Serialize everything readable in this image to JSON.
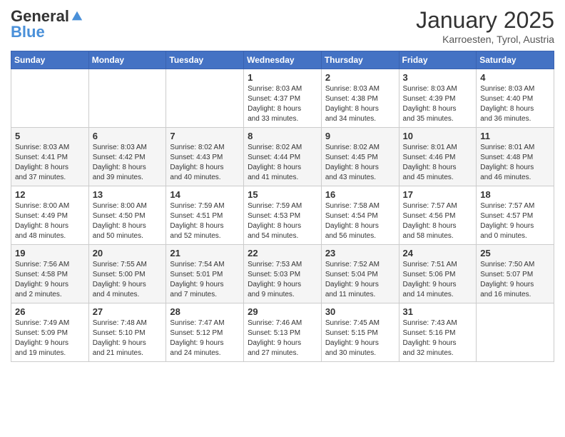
{
  "header": {
    "logo_general": "General",
    "logo_blue": "Blue",
    "month": "January 2025",
    "location": "Karroesten, Tyrol, Austria"
  },
  "weekdays": [
    "Sunday",
    "Monday",
    "Tuesday",
    "Wednesday",
    "Thursday",
    "Friday",
    "Saturday"
  ],
  "weeks": [
    [
      {
        "day": "",
        "info": ""
      },
      {
        "day": "",
        "info": ""
      },
      {
        "day": "",
        "info": ""
      },
      {
        "day": "1",
        "info": "Sunrise: 8:03 AM\nSunset: 4:37 PM\nDaylight: 8 hours\nand 33 minutes."
      },
      {
        "day": "2",
        "info": "Sunrise: 8:03 AM\nSunset: 4:38 PM\nDaylight: 8 hours\nand 34 minutes."
      },
      {
        "day": "3",
        "info": "Sunrise: 8:03 AM\nSunset: 4:39 PM\nDaylight: 8 hours\nand 35 minutes."
      },
      {
        "day": "4",
        "info": "Sunrise: 8:03 AM\nSunset: 4:40 PM\nDaylight: 8 hours\nand 36 minutes."
      }
    ],
    [
      {
        "day": "5",
        "info": "Sunrise: 8:03 AM\nSunset: 4:41 PM\nDaylight: 8 hours\nand 37 minutes."
      },
      {
        "day": "6",
        "info": "Sunrise: 8:03 AM\nSunset: 4:42 PM\nDaylight: 8 hours\nand 39 minutes."
      },
      {
        "day": "7",
        "info": "Sunrise: 8:02 AM\nSunset: 4:43 PM\nDaylight: 8 hours\nand 40 minutes."
      },
      {
        "day": "8",
        "info": "Sunrise: 8:02 AM\nSunset: 4:44 PM\nDaylight: 8 hours\nand 41 minutes."
      },
      {
        "day": "9",
        "info": "Sunrise: 8:02 AM\nSunset: 4:45 PM\nDaylight: 8 hours\nand 43 minutes."
      },
      {
        "day": "10",
        "info": "Sunrise: 8:01 AM\nSunset: 4:46 PM\nDaylight: 8 hours\nand 45 minutes."
      },
      {
        "day": "11",
        "info": "Sunrise: 8:01 AM\nSunset: 4:48 PM\nDaylight: 8 hours\nand 46 minutes."
      }
    ],
    [
      {
        "day": "12",
        "info": "Sunrise: 8:00 AM\nSunset: 4:49 PM\nDaylight: 8 hours\nand 48 minutes."
      },
      {
        "day": "13",
        "info": "Sunrise: 8:00 AM\nSunset: 4:50 PM\nDaylight: 8 hours\nand 50 minutes."
      },
      {
        "day": "14",
        "info": "Sunrise: 7:59 AM\nSunset: 4:51 PM\nDaylight: 8 hours\nand 52 minutes."
      },
      {
        "day": "15",
        "info": "Sunrise: 7:59 AM\nSunset: 4:53 PM\nDaylight: 8 hours\nand 54 minutes."
      },
      {
        "day": "16",
        "info": "Sunrise: 7:58 AM\nSunset: 4:54 PM\nDaylight: 8 hours\nand 56 minutes."
      },
      {
        "day": "17",
        "info": "Sunrise: 7:57 AM\nSunset: 4:56 PM\nDaylight: 8 hours\nand 58 minutes."
      },
      {
        "day": "18",
        "info": "Sunrise: 7:57 AM\nSunset: 4:57 PM\nDaylight: 9 hours\nand 0 minutes."
      }
    ],
    [
      {
        "day": "19",
        "info": "Sunrise: 7:56 AM\nSunset: 4:58 PM\nDaylight: 9 hours\nand 2 minutes."
      },
      {
        "day": "20",
        "info": "Sunrise: 7:55 AM\nSunset: 5:00 PM\nDaylight: 9 hours\nand 4 minutes."
      },
      {
        "day": "21",
        "info": "Sunrise: 7:54 AM\nSunset: 5:01 PM\nDaylight: 9 hours\nand 7 minutes."
      },
      {
        "day": "22",
        "info": "Sunrise: 7:53 AM\nSunset: 5:03 PM\nDaylight: 9 hours\nand 9 minutes."
      },
      {
        "day": "23",
        "info": "Sunrise: 7:52 AM\nSunset: 5:04 PM\nDaylight: 9 hours\nand 11 minutes."
      },
      {
        "day": "24",
        "info": "Sunrise: 7:51 AM\nSunset: 5:06 PM\nDaylight: 9 hours\nand 14 minutes."
      },
      {
        "day": "25",
        "info": "Sunrise: 7:50 AM\nSunset: 5:07 PM\nDaylight: 9 hours\nand 16 minutes."
      }
    ],
    [
      {
        "day": "26",
        "info": "Sunrise: 7:49 AM\nSunset: 5:09 PM\nDaylight: 9 hours\nand 19 minutes."
      },
      {
        "day": "27",
        "info": "Sunrise: 7:48 AM\nSunset: 5:10 PM\nDaylight: 9 hours\nand 21 minutes."
      },
      {
        "day": "28",
        "info": "Sunrise: 7:47 AM\nSunset: 5:12 PM\nDaylight: 9 hours\nand 24 minutes."
      },
      {
        "day": "29",
        "info": "Sunrise: 7:46 AM\nSunset: 5:13 PM\nDaylight: 9 hours\nand 27 minutes."
      },
      {
        "day": "30",
        "info": "Sunrise: 7:45 AM\nSunset: 5:15 PM\nDaylight: 9 hours\nand 30 minutes."
      },
      {
        "day": "31",
        "info": "Sunrise: 7:43 AM\nSunset: 5:16 PM\nDaylight: 9 hours\nand 32 minutes."
      },
      {
        "day": "",
        "info": ""
      }
    ]
  ]
}
